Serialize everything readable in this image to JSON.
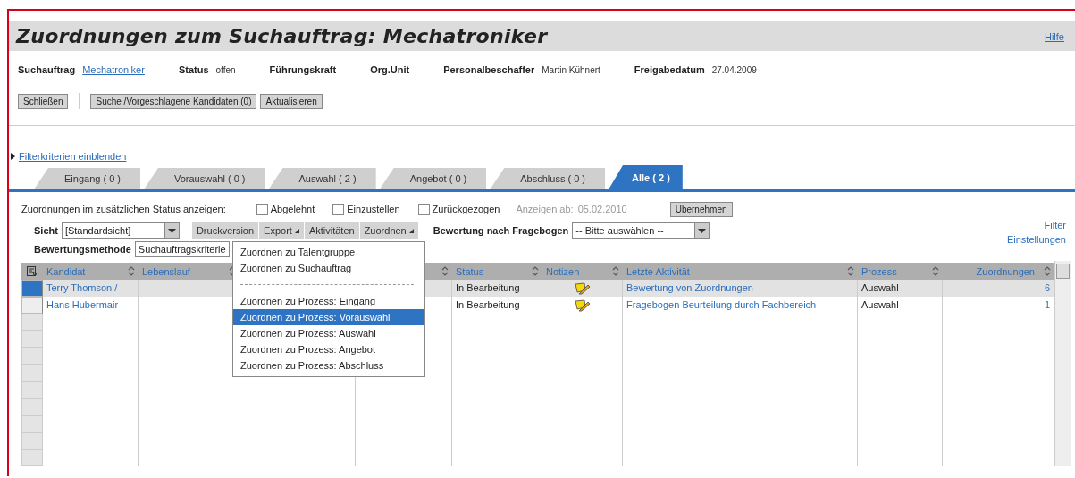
{
  "title": "Zuordnungen zum Suchauftrag: Mechatroniker",
  "help_link": "Hilfe",
  "info": [
    {
      "label": "Suchauftrag",
      "value": "Mechatroniker",
      "kind": "link"
    },
    {
      "label": "Status",
      "value": "offen",
      "kind": "text"
    },
    {
      "label": "Führungskraft"
    },
    {
      "label": "Org.Unit"
    },
    {
      "label": "Personalbeschaffer",
      "value": "Martin Kühnert",
      "kind": "text"
    },
    {
      "label": "Freigabedatum",
      "value": "27.04.2009",
      "kind": "text"
    }
  ],
  "actions": [
    "Schließen",
    "Suche /Vorgeschlagene Kandidaten (0)",
    "Aktualisieren"
  ],
  "filter_link": "Filterkriterien einblenden",
  "tabs": [
    {
      "label": "Eingang ( 0 )",
      "selected": false
    },
    {
      "label": "Vorauswahl ( 0 )",
      "selected": false
    },
    {
      "label": "Auswahl ( 2 )",
      "selected": false
    },
    {
      "label": "Angebot ( 0 )",
      "selected": false
    },
    {
      "label": "Abschluss ( 0 )",
      "selected": false
    },
    {
      "label": "Alle ( 2 )",
      "selected": true
    }
  ],
  "status_filter": {
    "label": "Zuordnungen im zusätzlichen Status anzeigen:",
    "options": [
      {
        "label": "Abgelehnt",
        "checked": false
      },
      {
        "label": "Einzustellen",
        "checked": false
      },
      {
        "label": "Zurückgezogen",
        "checked": false
      }
    ],
    "date_label": "Anzeigen ab:",
    "date_value": "05.02.2010",
    "apply_button": "Übernehmen"
  },
  "view": {
    "label": "Sicht",
    "value": "[Standardsicht]"
  },
  "toolbar": [
    {
      "label": "Druckversion",
      "dropdown": false
    },
    {
      "label": "Export",
      "dropdown": true
    },
    {
      "label": "Aktivitäten",
      "dropdown": false
    },
    {
      "label": "Zuordnen",
      "dropdown": true
    }
  ],
  "questionnaire": {
    "label": "Bewertung nach Fragebogen",
    "value": "-- Bitte auswählen --"
  },
  "method": {
    "label": "Bewertungsmethode",
    "value": "Suchauftragskriterie"
  },
  "side_links": [
    "Filter",
    "Einstellungen"
  ],
  "menu": [
    {
      "kind": "item",
      "label": "Zuordnen zu Talentgruppe",
      "selected": false
    },
    {
      "kind": "item",
      "label": "Zuordnen zu Suchauftrag",
      "selected": false
    },
    {
      "kind": "separator"
    },
    {
      "kind": "item",
      "label": "Zuordnen zu Prozess: Eingang",
      "selected": false
    },
    {
      "kind": "item",
      "label": "Zuordnen zu Prozess: Vorauswahl",
      "selected": true
    },
    {
      "kind": "item",
      "label": "Zuordnen zu Prozess: Auswahl",
      "selected": false
    },
    {
      "kind": "item",
      "label": "Zuordnen zu Prozess: Angebot",
      "selected": false
    },
    {
      "kind": "item",
      "label": "Zuordnen zu Prozess: Abschluss",
      "selected": false
    }
  ],
  "table": {
    "columns": [
      {
        "label": "Kandidat"
      },
      {
        "label": "Lebenslauf"
      },
      {},
      {},
      {
        "label": "Status"
      },
      {
        "label": "Notizen"
      },
      {
        "label": "Letzte Aktivität"
      },
      {
        "label": "Prozess"
      },
      {
        "label": "Zuordnungen"
      }
    ],
    "rows": [
      {
        "selected": true,
        "candidate": "Terry Thomson /",
        "status": "In Bearbeitung",
        "has_note": true,
        "activity": "Bewertung von Zuordnungen",
        "process": "Auswahl",
        "count": "6"
      },
      {
        "selected": false,
        "candidate": "Hans Hubermair",
        "status": "In Bearbeitung",
        "has_note": true,
        "activity": "Fragebogen Beurteilung durch Fachbereich",
        "process": "Auswahl",
        "count": "1"
      }
    ]
  }
}
